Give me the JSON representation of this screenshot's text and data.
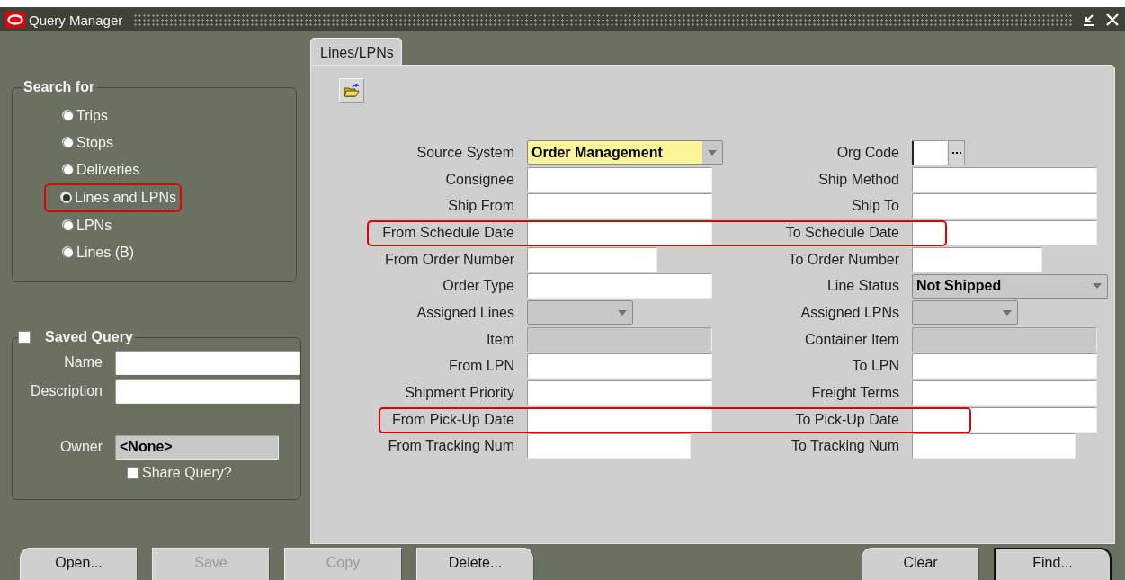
{
  "window": {
    "title": "Query Manager"
  },
  "search_for": {
    "title": "Search for",
    "options": [
      {
        "label": "Trips",
        "selected": false,
        "highlighted": false
      },
      {
        "label": "Stops",
        "selected": false,
        "highlighted": false
      },
      {
        "label": "Deliveries",
        "selected": false,
        "highlighted": false
      },
      {
        "label": "Lines and LPNs",
        "selected": true,
        "highlighted": true
      },
      {
        "label": "LPNs",
        "selected": false,
        "highlighted": false
      },
      {
        "label": "Lines (B)",
        "selected": false,
        "highlighted": false
      }
    ]
  },
  "saved_query": {
    "title": "Saved Query",
    "checked": false,
    "fields": [
      {
        "label": "Name",
        "kind": "text"
      },
      {
        "label": "Description",
        "kind": "text"
      },
      {
        "label": "Owner",
        "kind": "readonly",
        "value": "<None>"
      }
    ],
    "share": {
      "label": "Share Query?",
      "checked": false
    }
  },
  "tabs": [
    {
      "label": "Lines/LPNs",
      "selected": true
    }
  ],
  "form": {
    "rows": [
      {
        "highlighted": false,
        "left": {
          "label": "Source System",
          "kind": "combo",
          "value": "Order Management",
          "required": true,
          "disabled": false
        },
        "right": {
          "label": "Org Code",
          "kind": "lov"
        }
      },
      {
        "highlighted": false,
        "left": {
          "label": "Consignee",
          "kind": "text"
        },
        "right": {
          "label": "Ship Method",
          "kind": "text"
        }
      },
      {
        "highlighted": false,
        "left": {
          "label": "Ship From",
          "kind": "text"
        },
        "right": {
          "label": "Ship To",
          "kind": "text"
        }
      },
      {
        "highlighted": true,
        "left": {
          "label": "From Schedule Date",
          "kind": "text"
        },
        "right": {
          "label": "To Schedule Date",
          "kind": "text"
        }
      },
      {
        "highlighted": false,
        "left": {
          "label": "From Order Number",
          "kind": "short-text"
        },
        "right": {
          "label": "To Order Number",
          "kind": "short-text"
        }
      },
      {
        "highlighted": false,
        "left": {
          "label": "Order Type",
          "kind": "text"
        },
        "right": {
          "label": "Line Status",
          "kind": "combo",
          "value": "Not Shipped",
          "required": false,
          "disabled": false
        }
      },
      {
        "highlighted": false,
        "left": {
          "label": "Assigned Lines",
          "kind": "combo",
          "required": false,
          "disabled": true
        },
        "right": {
          "label": "Assigned LPNs",
          "kind": "combo",
          "required": false,
          "disabled": true
        }
      },
      {
        "highlighted": false,
        "left": {
          "label": "Item",
          "kind": "readonly"
        },
        "right": {
          "label": "Container Item",
          "kind": "readonly"
        }
      },
      {
        "highlighted": false,
        "left": {
          "label": "From LPN",
          "kind": "text"
        },
        "right": {
          "label": "To LPN",
          "kind": "text"
        }
      },
      {
        "highlighted": false,
        "left": {
          "label": "Shipment Priority",
          "kind": "text"
        },
        "right": {
          "label": "Freight Terms",
          "kind": "text"
        }
      },
      {
        "highlighted": true,
        "left": {
          "label": "From Pick-Up Date",
          "kind": "text"
        },
        "right": {
          "label": "To Pick-Up Date",
          "kind": "text"
        }
      },
      {
        "highlighted": false,
        "left": {
          "label": "From Tracking Num",
          "kind": "medium-text"
        },
        "right": {
          "label": "To Tracking Num",
          "kind": "medium-text"
        }
      }
    ]
  },
  "footer": {
    "left_buttons": [
      {
        "label": "Open...",
        "disabled": false,
        "default": false
      },
      {
        "label": "Save",
        "disabled": true,
        "default": false
      },
      {
        "label": "Copy",
        "disabled": true,
        "default": false
      },
      {
        "label": "Delete...",
        "disabled": false,
        "default": false
      }
    ],
    "right_buttons": [
      {
        "label": "Clear",
        "disabled": false,
        "default": false
      },
      {
        "label": "Find...",
        "disabled": false,
        "default": true
      }
    ]
  }
}
